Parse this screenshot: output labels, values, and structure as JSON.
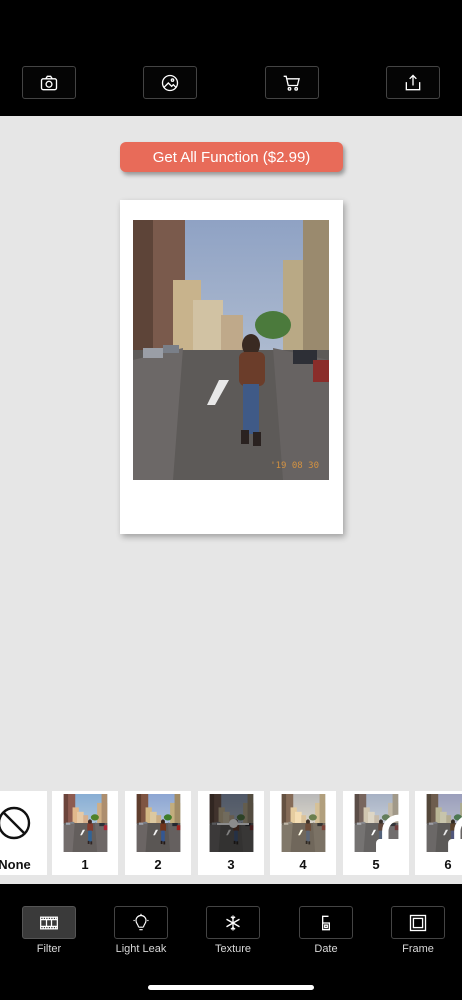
{
  "toolbar": {
    "camera_icon": "camera-icon",
    "gallery_icon": "image-icon",
    "cart_icon": "cart-icon",
    "share_icon": "share-icon"
  },
  "promo": {
    "label": "Get All Function ($2.99)",
    "color": "#e86b59"
  },
  "photo": {
    "date_stamp": "'19 08 30"
  },
  "filters": [
    {
      "label": "None",
      "icon": "prohibited-icon"
    },
    {
      "label": "1",
      "locked": false
    },
    {
      "label": "2",
      "locked": false
    },
    {
      "label": "3",
      "locked": false,
      "has_slider": true
    },
    {
      "label": "4",
      "locked": false
    },
    {
      "label": "5",
      "locked": true
    },
    {
      "label": "6",
      "locked": true
    }
  ],
  "bottom_tabs": [
    {
      "label": "Filter",
      "icon": "film-icon",
      "active": true
    },
    {
      "label": "Light Leak",
      "icon": "lightbulb-icon",
      "active": false
    },
    {
      "label": "Texture",
      "icon": "snowflake-icon",
      "active": false
    },
    {
      "label": "Date",
      "icon": "date-digit-icon",
      "active": false
    },
    {
      "label": "Frame",
      "icon": "frame-icon",
      "active": false
    }
  ]
}
